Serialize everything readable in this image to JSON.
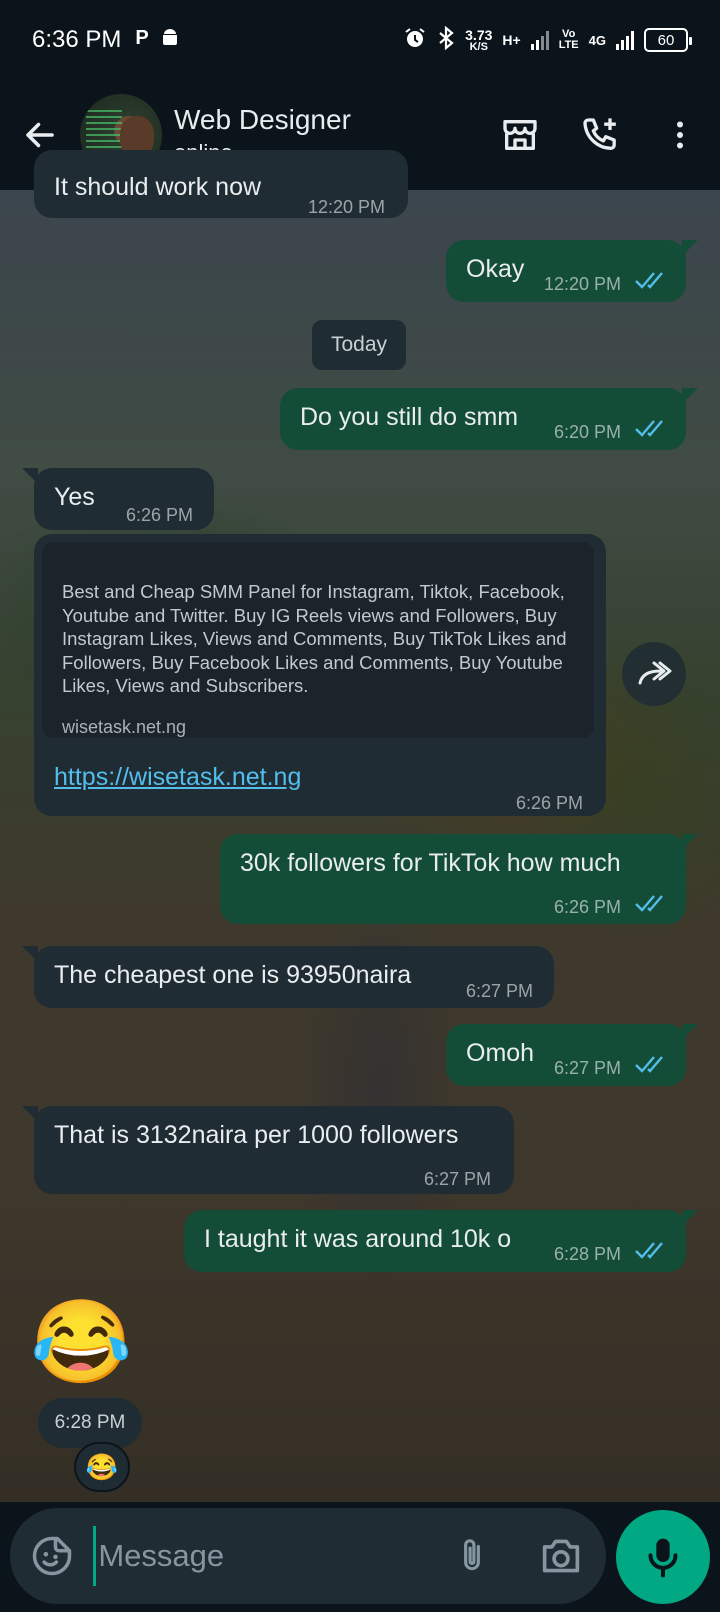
{
  "status_bar": {
    "time": "6:36 PM",
    "speed_value": "3.73",
    "speed_unit": "K/S",
    "net_type": "H+",
    "volte_top": "Vo",
    "volte_bottom": "LTE",
    "net_4g": "4G",
    "battery": "60"
  },
  "header": {
    "contact_name": "Web Designer",
    "contact_status": "online"
  },
  "date_chip": "Today",
  "messages": [
    {
      "text": "It should work now",
      "time": "12:20 PM"
    },
    {
      "text": "Okay",
      "time": "12:20 PM"
    },
    {
      "text": "Do you still do smm",
      "time": "6:20 PM"
    },
    {
      "text": "Yes",
      "time": "6:26 PM"
    },
    {
      "preview_description": "Best and Cheap SMM Panel for Instagram, Tiktok, Facebook, Youtube and Twitter. Buy IG Reels views and Followers, Buy Instagram Likes, Views and Comments, Buy TikTok Likes and Followers, Buy Facebook Likes and Comments, Buy Youtube Likes, Views and Subscribers.",
      "preview_domain": "wisetask.net.ng",
      "text": "https://wisetask.net.ng",
      "time": "6:26 PM"
    },
    {
      "text": "30k followers for TikTok how much",
      "time": "6:26 PM"
    },
    {
      "text": "The cheapest one is 93950naira",
      "time": "6:27 PM"
    },
    {
      "text": "Omoh",
      "time": "6:27 PM"
    },
    {
      "text": "That is 3132naira per 1000 followers",
      "time": "6:27 PM"
    },
    {
      "text": "I taught it was around 10k o",
      "time": "6:28 PM"
    },
    {
      "text": "😂",
      "time": "6:28 PM",
      "reaction": "😂"
    }
  ],
  "input": {
    "placeholder": "Message"
  },
  "colors": {
    "background": "#0b141a",
    "incoming_bubble": "#1f2c33",
    "outgoing_bubble": "#144d37",
    "accent": "#00a884",
    "read_ticks": "#53bdeb"
  }
}
